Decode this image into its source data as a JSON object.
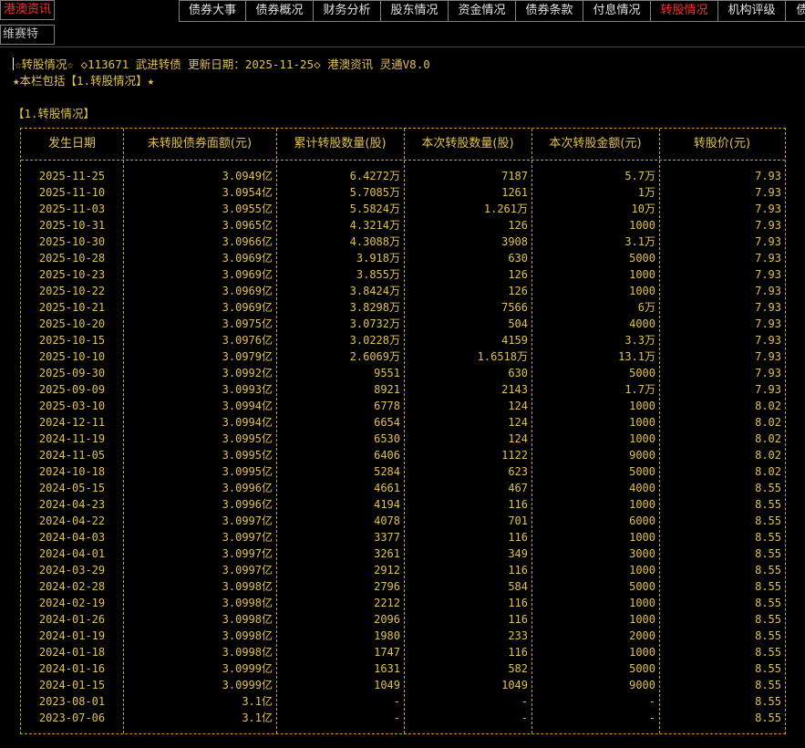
{
  "app": {
    "brand": "港澳资讯",
    "sub_label": "维赛特"
  },
  "tabs": [
    {
      "label": "债券大事",
      "active": false
    },
    {
      "label": "债券概况",
      "active": false
    },
    {
      "label": "财务分析",
      "active": false
    },
    {
      "label": "股东情况",
      "active": false
    },
    {
      "label": "资金情况",
      "active": false
    },
    {
      "label": "债券条款",
      "active": false
    },
    {
      "label": "付息情况",
      "active": false
    },
    {
      "label": "转股情况",
      "active": true
    },
    {
      "label": "机构评级",
      "active": false
    },
    {
      "label": "债",
      "active": false
    }
  ],
  "header": {
    "line1": "☆转股情况☆ ◇113671 武进转债 更新日期：2025-11-25◇ 港澳资讯 灵通V8.0",
    "line2": "★本栏包括【1.转股情况】★",
    "section_title": "【1.转股情况】"
  },
  "table": {
    "columns": [
      "发生日期",
      "未转股债券面额(元)",
      "累计转股数量(股)",
      "本次转股数量(股)",
      "本次转股金额(元)",
      "转股价(元)"
    ],
    "rows": [
      [
        "2025-11-25",
        "3.0949亿",
        "6.4272万",
        "7187",
        "5.7万",
        "7.93"
      ],
      [
        "2025-11-10",
        "3.0954亿",
        "5.7085万",
        "1261",
        "1万",
        "7.93"
      ],
      [
        "2025-11-03",
        "3.0955亿",
        "5.5824万",
        "1.261万",
        "10万",
        "7.93"
      ],
      [
        "2025-10-31",
        "3.0965亿",
        "4.3214万",
        "126",
        "1000",
        "7.93"
      ],
      [
        "2025-10-30",
        "3.0966亿",
        "4.3088万",
        "3908",
        "3.1万",
        "7.93"
      ],
      [
        "2025-10-28",
        "3.0969亿",
        "3.918万",
        "630",
        "5000",
        "7.93"
      ],
      [
        "2025-10-23",
        "3.0969亿",
        "3.855万",
        "126",
        "1000",
        "7.93"
      ],
      [
        "2025-10-22",
        "3.0969亿",
        "3.8424万",
        "126",
        "1000",
        "7.93"
      ],
      [
        "2025-10-21",
        "3.0969亿",
        "3.8298万",
        "7566",
        "6万",
        "7.93"
      ],
      [
        "2025-10-20",
        "3.0975亿",
        "3.0732万",
        "504",
        "4000",
        "7.93"
      ],
      [
        "2025-10-15",
        "3.0976亿",
        "3.0228万",
        "4159",
        "3.3万",
        "7.93"
      ],
      [
        "2025-10-10",
        "3.0979亿",
        "2.6069万",
        "1.6518万",
        "13.1万",
        "7.93"
      ],
      [
        "2025-09-30",
        "3.0992亿",
        "9551",
        "630",
        "5000",
        "7.93"
      ],
      [
        "2025-09-09",
        "3.0993亿",
        "8921",
        "2143",
        "1.7万",
        "7.93"
      ],
      [
        "2025-03-10",
        "3.0994亿",
        "6778",
        "124",
        "1000",
        "8.02"
      ],
      [
        "2024-12-11",
        "3.0994亿",
        "6654",
        "124",
        "1000",
        "8.02"
      ],
      [
        "2024-11-19",
        "3.0995亿",
        "6530",
        "124",
        "1000",
        "8.02"
      ],
      [
        "2024-11-05",
        "3.0995亿",
        "6406",
        "1122",
        "9000",
        "8.02"
      ],
      [
        "2024-10-18",
        "3.0995亿",
        "5284",
        "623",
        "5000",
        "8.02"
      ],
      [
        "2024-05-15",
        "3.0996亿",
        "4661",
        "467",
        "4000",
        "8.55"
      ],
      [
        "2024-04-23",
        "3.0996亿",
        "4194",
        "116",
        "1000",
        "8.55"
      ],
      [
        "2024-04-22",
        "3.0997亿",
        "4078",
        "701",
        "6000",
        "8.55"
      ],
      [
        "2024-04-03",
        "3.0997亿",
        "3377",
        "116",
        "1000",
        "8.55"
      ],
      [
        "2024-04-01",
        "3.0997亿",
        "3261",
        "349",
        "3000",
        "8.55"
      ],
      [
        "2024-03-29",
        "3.0997亿",
        "2912",
        "116",
        "1000",
        "8.55"
      ],
      [
        "2024-02-28",
        "3.0998亿",
        "2796",
        "584",
        "5000",
        "8.55"
      ],
      [
        "2024-02-19",
        "3.0998亿",
        "2212",
        "116",
        "1000",
        "8.55"
      ],
      [
        "2024-01-26",
        "3.0998亿",
        "2096",
        "116",
        "1000",
        "8.55"
      ],
      [
        "2024-01-19",
        "3.0998亿",
        "1980",
        "233",
        "2000",
        "8.55"
      ],
      [
        "2024-01-18",
        "3.0998亿",
        "1747",
        "116",
        "1000",
        "8.55"
      ],
      [
        "2024-01-16",
        "3.0999亿",
        "1631",
        "582",
        "5000",
        "8.55"
      ],
      [
        "2024-01-15",
        "3.0999亿",
        "1049",
        "1049",
        "9000",
        "8.55"
      ],
      [
        "2023-08-01",
        "3.1亿",
        "-",
        "-",
        "-",
        "8.55"
      ],
      [
        "2023-07-06",
        "3.1亿",
        "-",
        "-",
        "-",
        "8.55"
      ]
    ]
  },
  "colors": {
    "background": "#000000",
    "text_yellow": "#e0c050",
    "active_tab": "#ff3030",
    "grid": "#c8a020"
  }
}
